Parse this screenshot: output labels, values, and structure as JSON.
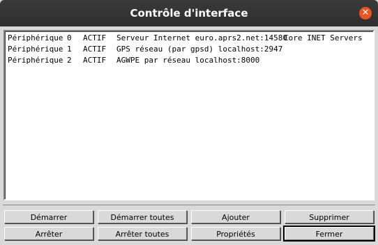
{
  "window": {
    "title": "Contrôle d'interface",
    "close_glyph": "✕"
  },
  "devices": [
    {
      "kind": "Périphérique",
      "num": "0",
      "state": "ACTIF",
      "desc": "Serveur Internet euro.aprs2.net:14580",
      "extra": "Core INET Servers"
    },
    {
      "kind": "Périphérique",
      "num": "1",
      "state": "ACTIF",
      "desc": "GPS réseau (par gpsd) localhost:2947",
      "extra": ""
    },
    {
      "kind": "Périphérique",
      "num": "2",
      "state": "ACTIF",
      "desc": "AGWPE par réseau localhost:8000",
      "extra": ""
    }
  ],
  "buttons": {
    "start": "Démarrer",
    "start_all": "Démarrer toutes",
    "add": "Ajouter",
    "delete": "Supprimer",
    "stop": "Arrêter",
    "stop_all": "Arrêter toutes",
    "properties": "Propriétés",
    "close": "Fermer"
  }
}
